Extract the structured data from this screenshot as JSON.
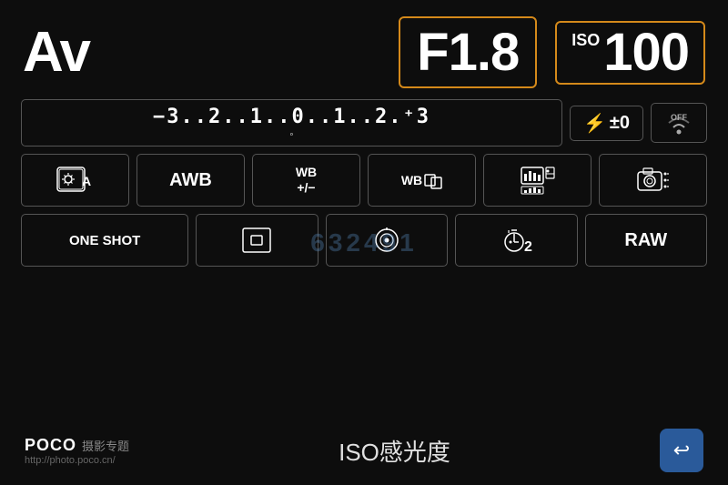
{
  "header": {
    "av_label": "Av",
    "aperture": "F1.8",
    "iso_label": "ISO",
    "iso_value": "100"
  },
  "ev_scale": {
    "text": "⁻3..2..1..0..1..2.⁺3",
    "display": "−3..2..1..Ó..1..2.⁺3",
    "marker": "◦"
  },
  "flash": {
    "symbol": "⚡±",
    "value": "±0"
  },
  "wifi": {
    "label": "OFF"
  },
  "row3_items": [
    {
      "id": "metering",
      "label": "⊠A"
    },
    {
      "id": "awb",
      "label": "AWB"
    },
    {
      "id": "wb_adjust",
      "label": "WB\n+/−"
    },
    {
      "id": "wb_bracket",
      "label": "WB⊡"
    },
    {
      "id": "display_mode",
      "label": "📊"
    },
    {
      "id": "camera_settings",
      "label": "📷⋮"
    }
  ],
  "row4_items": [
    {
      "id": "af_mode",
      "label": "ONE SHOT"
    },
    {
      "id": "af_point",
      "label": "⊡"
    },
    {
      "id": "liveview",
      "label": "🔵"
    },
    {
      "id": "timer",
      "label": "⏱2"
    },
    {
      "id": "raw",
      "label": "RAW"
    }
  ],
  "bottom": {
    "poco_text": "POCO",
    "poco_sub": "摄影专题",
    "poco_url": "http://photo.poco.cn/",
    "iso_caption": "ISO感光度",
    "back_arrow": "↩"
  },
  "watermark": "632491"
}
